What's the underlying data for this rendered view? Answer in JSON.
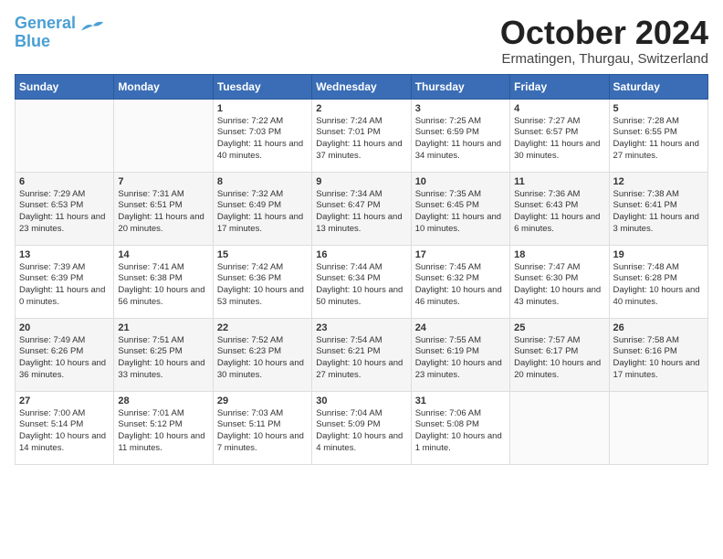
{
  "header": {
    "logo_line1": "General",
    "logo_line2": "Blue",
    "month": "October 2024",
    "location": "Ermatingen, Thurgau, Switzerland"
  },
  "weekdays": [
    "Sunday",
    "Monday",
    "Tuesday",
    "Wednesday",
    "Thursday",
    "Friday",
    "Saturday"
  ],
  "weeks": [
    [
      {
        "day": "",
        "content": ""
      },
      {
        "day": "",
        "content": ""
      },
      {
        "day": "1",
        "content": "Sunrise: 7:22 AM\nSunset: 7:03 PM\nDaylight: 11 hours and 40 minutes."
      },
      {
        "day": "2",
        "content": "Sunrise: 7:24 AM\nSunset: 7:01 PM\nDaylight: 11 hours and 37 minutes."
      },
      {
        "day": "3",
        "content": "Sunrise: 7:25 AM\nSunset: 6:59 PM\nDaylight: 11 hours and 34 minutes."
      },
      {
        "day": "4",
        "content": "Sunrise: 7:27 AM\nSunset: 6:57 PM\nDaylight: 11 hours and 30 minutes."
      },
      {
        "day": "5",
        "content": "Sunrise: 7:28 AM\nSunset: 6:55 PM\nDaylight: 11 hours and 27 minutes."
      }
    ],
    [
      {
        "day": "6",
        "content": "Sunrise: 7:29 AM\nSunset: 6:53 PM\nDaylight: 11 hours and 23 minutes."
      },
      {
        "day": "7",
        "content": "Sunrise: 7:31 AM\nSunset: 6:51 PM\nDaylight: 11 hours and 20 minutes."
      },
      {
        "day": "8",
        "content": "Sunrise: 7:32 AM\nSunset: 6:49 PM\nDaylight: 11 hours and 17 minutes."
      },
      {
        "day": "9",
        "content": "Sunrise: 7:34 AM\nSunset: 6:47 PM\nDaylight: 11 hours and 13 minutes."
      },
      {
        "day": "10",
        "content": "Sunrise: 7:35 AM\nSunset: 6:45 PM\nDaylight: 11 hours and 10 minutes."
      },
      {
        "day": "11",
        "content": "Sunrise: 7:36 AM\nSunset: 6:43 PM\nDaylight: 11 hours and 6 minutes."
      },
      {
        "day": "12",
        "content": "Sunrise: 7:38 AM\nSunset: 6:41 PM\nDaylight: 11 hours and 3 minutes."
      }
    ],
    [
      {
        "day": "13",
        "content": "Sunrise: 7:39 AM\nSunset: 6:39 PM\nDaylight: 11 hours and 0 minutes."
      },
      {
        "day": "14",
        "content": "Sunrise: 7:41 AM\nSunset: 6:38 PM\nDaylight: 10 hours and 56 minutes."
      },
      {
        "day": "15",
        "content": "Sunrise: 7:42 AM\nSunset: 6:36 PM\nDaylight: 10 hours and 53 minutes."
      },
      {
        "day": "16",
        "content": "Sunrise: 7:44 AM\nSunset: 6:34 PM\nDaylight: 10 hours and 50 minutes."
      },
      {
        "day": "17",
        "content": "Sunrise: 7:45 AM\nSunset: 6:32 PM\nDaylight: 10 hours and 46 minutes."
      },
      {
        "day": "18",
        "content": "Sunrise: 7:47 AM\nSunset: 6:30 PM\nDaylight: 10 hours and 43 minutes."
      },
      {
        "day": "19",
        "content": "Sunrise: 7:48 AM\nSunset: 6:28 PM\nDaylight: 10 hours and 40 minutes."
      }
    ],
    [
      {
        "day": "20",
        "content": "Sunrise: 7:49 AM\nSunset: 6:26 PM\nDaylight: 10 hours and 36 minutes."
      },
      {
        "day": "21",
        "content": "Sunrise: 7:51 AM\nSunset: 6:25 PM\nDaylight: 10 hours and 33 minutes."
      },
      {
        "day": "22",
        "content": "Sunrise: 7:52 AM\nSunset: 6:23 PM\nDaylight: 10 hours and 30 minutes."
      },
      {
        "day": "23",
        "content": "Sunrise: 7:54 AM\nSunset: 6:21 PM\nDaylight: 10 hours and 27 minutes."
      },
      {
        "day": "24",
        "content": "Sunrise: 7:55 AM\nSunset: 6:19 PM\nDaylight: 10 hours and 23 minutes."
      },
      {
        "day": "25",
        "content": "Sunrise: 7:57 AM\nSunset: 6:17 PM\nDaylight: 10 hours and 20 minutes."
      },
      {
        "day": "26",
        "content": "Sunrise: 7:58 AM\nSunset: 6:16 PM\nDaylight: 10 hours and 17 minutes."
      }
    ],
    [
      {
        "day": "27",
        "content": "Sunrise: 7:00 AM\nSunset: 5:14 PM\nDaylight: 10 hours and 14 minutes."
      },
      {
        "day": "28",
        "content": "Sunrise: 7:01 AM\nSunset: 5:12 PM\nDaylight: 10 hours and 11 minutes."
      },
      {
        "day": "29",
        "content": "Sunrise: 7:03 AM\nSunset: 5:11 PM\nDaylight: 10 hours and 7 minutes."
      },
      {
        "day": "30",
        "content": "Sunrise: 7:04 AM\nSunset: 5:09 PM\nDaylight: 10 hours and 4 minutes."
      },
      {
        "day": "31",
        "content": "Sunrise: 7:06 AM\nSunset: 5:08 PM\nDaylight: 10 hours and 1 minute."
      },
      {
        "day": "",
        "content": ""
      },
      {
        "day": "",
        "content": ""
      }
    ]
  ]
}
